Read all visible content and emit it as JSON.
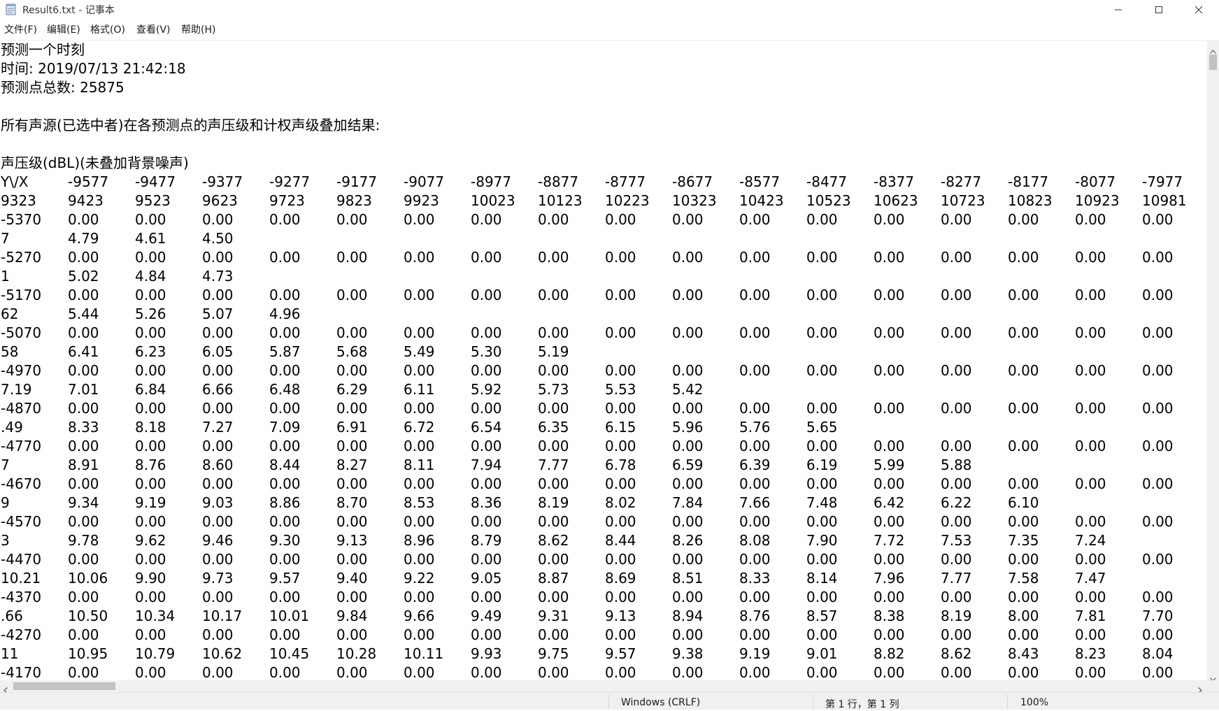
{
  "window": {
    "title": "Result6.txt - 记事本",
    "icon": "notepad-icon",
    "controls": [
      "minimize-icon",
      "maximize-icon",
      "close-icon"
    ]
  },
  "menu": [
    {
      "label": "文件(F)"
    },
    {
      "label": "编辑(E)"
    },
    {
      "label": "格式(O)"
    },
    {
      "label": "查看(V)"
    },
    {
      "label": "帮助(H)"
    }
  ],
  "document": {
    "header_lines": [
      "预测一个时刻",
      "时间: 2019/07/13 21:42:18",
      "预测点总数: 25875",
      "",
      "所有声源(已选中者)在各预测点的声压级和计权声级叠加结果:",
      "",
      "声压级(dBL)(未叠加背景噪声)"
    ],
    "grid_rows": [
      [
        "Y\\/X",
        "-9577",
        "-9477",
        "-9377",
        "-9277",
        "-9177",
        "-9077",
        "-8977",
        "-8877",
        "-8777",
        "-8677",
        "-8577",
        "-8477",
        "-8377",
        "-8277",
        "-8177",
        "-8077",
        "-7977"
      ],
      [
        "9323",
        "9423",
        "9523",
        "9623",
        "9723",
        "9823",
        "9923",
        "10023",
        "10123",
        "10223",
        "10323",
        "10423",
        "10523",
        "10623",
        "10723",
        "10823",
        "10923",
        "10981"
      ],
      [
        "-5370",
        "0.00",
        "0.00",
        "0.00",
        "0.00",
        "0.00",
        "0.00",
        "0.00",
        "0.00",
        "0.00",
        "0.00",
        "0.00",
        "0.00",
        "0.00",
        "0.00",
        "0.00",
        "0.00",
        "0.00"
      ],
      [
        "7",
        "4.79",
        "4.61",
        "4.50"
      ],
      [
        "-5270",
        "0.00",
        "0.00",
        "0.00",
        "0.00",
        "0.00",
        "0.00",
        "0.00",
        "0.00",
        "0.00",
        "0.00",
        "0.00",
        "0.00",
        "0.00",
        "0.00",
        "0.00",
        "0.00",
        "0.00"
      ],
      [
        "1",
        "5.02",
        "4.84",
        "4.73"
      ],
      [
        "-5170",
        "0.00",
        "0.00",
        "0.00",
        "0.00",
        "0.00",
        "0.00",
        "0.00",
        "0.00",
        "0.00",
        "0.00",
        "0.00",
        "0.00",
        "0.00",
        "0.00",
        "0.00",
        "0.00",
        "0.00"
      ],
      [
        "62",
        "5.44",
        "5.26",
        "5.07",
        "4.96"
      ],
      [
        "-5070",
        "0.00",
        "0.00",
        "0.00",
        "0.00",
        "0.00",
        "0.00",
        "0.00",
        "0.00",
        "0.00",
        "0.00",
        "0.00",
        "0.00",
        "0.00",
        "0.00",
        "0.00",
        "0.00",
        "0.00"
      ],
      [
        "58",
        "6.41",
        "6.23",
        "6.05",
        "5.87",
        "5.68",
        "5.49",
        "5.30",
        "5.19"
      ],
      [
        "-4970",
        "0.00",
        "0.00",
        "0.00",
        "0.00",
        "0.00",
        "0.00",
        "0.00",
        "0.00",
        "0.00",
        "0.00",
        "0.00",
        "0.00",
        "0.00",
        "0.00",
        "0.00",
        "0.00",
        "0.00"
      ],
      [
        "7.19",
        "7.01",
        "6.84",
        "6.66",
        "6.48",
        "6.29",
        "6.11",
        "5.92",
        "5.73",
        "5.53",
        "5.42"
      ],
      [
        "-4870",
        "0.00",
        "0.00",
        "0.00",
        "0.00",
        "0.00",
        "0.00",
        "0.00",
        "0.00",
        "0.00",
        "0.00",
        "0.00",
        "0.00",
        "0.00",
        "0.00",
        "0.00",
        "0.00",
        "0.00"
      ],
      [
        ".49",
        "8.33",
        "8.18",
        "7.27",
        "7.09",
        "6.91",
        "6.72",
        "6.54",
        "6.35",
        "6.15",
        "5.96",
        "5.76",
        "5.65"
      ],
      [
        "-4770",
        "0.00",
        "0.00",
        "0.00",
        "0.00",
        "0.00",
        "0.00",
        "0.00",
        "0.00",
        "0.00",
        "0.00",
        "0.00",
        "0.00",
        "0.00",
        "0.00",
        "0.00",
        "0.00",
        "0.00"
      ],
      [
        "7",
        "8.91",
        "8.76",
        "8.60",
        "8.44",
        "8.27",
        "8.11",
        "7.94",
        "7.77",
        "6.78",
        "6.59",
        "6.39",
        "6.19",
        "5.99",
        "5.88"
      ],
      [
        "-4670",
        "0.00",
        "0.00",
        "0.00",
        "0.00",
        "0.00",
        "0.00",
        "0.00",
        "0.00",
        "0.00",
        "0.00",
        "0.00",
        "0.00",
        "0.00",
        "0.00",
        "0.00",
        "0.00",
        "0.00"
      ],
      [
        "9",
        "9.34",
        "9.19",
        "9.03",
        "8.86",
        "8.70",
        "8.53",
        "8.36",
        "8.19",
        "8.02",
        "7.84",
        "7.66",
        "7.48",
        "6.42",
        "6.22",
        "6.10"
      ],
      [
        "-4570",
        "0.00",
        "0.00",
        "0.00",
        "0.00",
        "0.00",
        "0.00",
        "0.00",
        "0.00",
        "0.00",
        "0.00",
        "0.00",
        "0.00",
        "0.00",
        "0.00",
        "0.00",
        "0.00",
        "0.00"
      ],
      [
        "3",
        "9.78",
        "9.62",
        "9.46",
        "9.30",
        "9.13",
        "8.96",
        "8.79",
        "8.62",
        "8.44",
        "8.26",
        "8.08",
        "7.90",
        "7.72",
        "7.53",
        "7.35",
        "7.24"
      ],
      [
        "-4470",
        "0.00",
        "0.00",
        "0.00",
        "0.00",
        "0.00",
        "0.00",
        "0.00",
        "0.00",
        "0.00",
        "0.00",
        "0.00",
        "0.00",
        "0.00",
        "0.00",
        "0.00",
        "0.00",
        "0.00"
      ],
      [
        "10.21",
        "10.06",
        "9.90",
        "9.73",
        "9.57",
        "9.40",
        "9.22",
        "9.05",
        "8.87",
        "8.69",
        "8.51",
        "8.33",
        "8.14",
        "7.96",
        "7.77",
        "7.58",
        "7.47"
      ],
      [
        "-4370",
        "0.00",
        "0.00",
        "0.00",
        "0.00",
        "0.00",
        "0.00",
        "0.00",
        "0.00",
        "0.00",
        "0.00",
        "0.00",
        "0.00",
        "0.00",
        "0.00",
        "0.00",
        "0.00",
        "0.00"
      ],
      [
        ".66",
        "10.50",
        "10.34",
        "10.17",
        "10.01",
        "9.84",
        "9.66",
        "9.49",
        "9.31",
        "9.13",
        "8.94",
        "8.76",
        "8.57",
        "8.38",
        "8.19",
        "8.00",
        "7.81",
        "7.70"
      ],
      [
        "-4270",
        "0.00",
        "0.00",
        "0.00",
        "0.00",
        "0.00",
        "0.00",
        "0.00",
        "0.00",
        "0.00",
        "0.00",
        "0.00",
        "0.00",
        "0.00",
        "0.00",
        "0.00",
        "0.00",
        "0.00"
      ],
      [
        "11",
        "10.95",
        "10.79",
        "10.62",
        "10.45",
        "10.28",
        "10.11",
        "9.93",
        "9.75",
        "9.57",
        "9.38",
        "9.19",
        "9.01",
        "8.82",
        "8.62",
        "8.43",
        "8.23",
        "8.04"
      ],
      [
        "-4170",
        "0.00",
        "0.00",
        "0.00",
        "0.00",
        "0.00",
        "0.00",
        "0.00",
        "0.00",
        "0.00",
        "0.00",
        "0.00",
        "0.00",
        "0.00",
        "0.00",
        "0.00",
        "0.00",
        "0.00"
      ]
    ]
  },
  "status": {
    "encoding": "Windows (CRLF)",
    "position": "第 1 行，第 1 列",
    "zoom": "100%"
  },
  "colors": {
    "background": "#ffffff",
    "text": "#000000",
    "chrome": "#f0f0f0",
    "scroll_thumb": "#c2c2c2"
  }
}
